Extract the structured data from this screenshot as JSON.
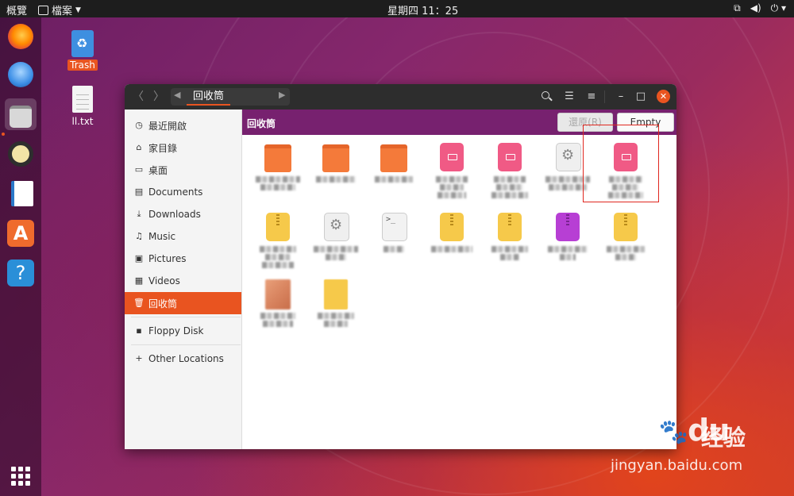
{
  "topbar": {
    "activities": "概覽",
    "app_menu": "檔案",
    "clock": "星期四 11：25",
    "status_icons": [
      "network-icon",
      "volume-icon",
      "power-icon"
    ]
  },
  "dock": {
    "apps": [
      "Firefox",
      "Thunderbird",
      "Files",
      "Rhythmbox",
      "LibreOffice Writer",
      "Ubuntu Software",
      "Help"
    ],
    "active": "Files"
  },
  "desktop": {
    "icons": [
      {
        "label": "Trash"
      },
      {
        "label": "ll.txt"
      }
    ]
  },
  "window": {
    "path": "回收筒",
    "location_label": "回收筒",
    "restore_label": "還原(R)",
    "empty_label": "Empty"
  },
  "sidebar": {
    "items": [
      {
        "label": "最近開啟",
        "icon": "clock-icon"
      },
      {
        "label": "家目錄",
        "icon": "home-icon"
      },
      {
        "label": "桌面",
        "icon": "desktop-icon"
      },
      {
        "label": "Documents",
        "icon": "document-icon"
      },
      {
        "label": "Downloads",
        "icon": "download-icon"
      },
      {
        "label": "Music",
        "icon": "music-icon"
      },
      {
        "label": "Pictures",
        "icon": "picture-icon"
      },
      {
        "label": "Videos",
        "icon": "video-icon"
      },
      {
        "label": "回收筒",
        "icon": "trash-icon"
      },
      {
        "label": "Floppy Disk",
        "icon": "floppy-icon"
      },
      {
        "label": "Other Locations",
        "icon": "plus-icon"
      }
    ],
    "active": "回收筒"
  },
  "files": [
    {
      "type": "folder",
      "name": "..."
    },
    {
      "type": "folder",
      "name": "..."
    },
    {
      "type": "folder",
      "name": "..."
    },
    {
      "type": "deb",
      "name": "..."
    },
    {
      "type": "deb",
      "name": "..."
    },
    {
      "type": "settings",
      "name": "..."
    },
    {
      "type": "deb",
      "name": "..."
    },
    {
      "type": "zip",
      "name": "..."
    },
    {
      "type": "settings",
      "name": "..."
    },
    {
      "type": "script",
      "name": "..."
    },
    {
      "type": "zip",
      "name": "..."
    },
    {
      "type": "zip",
      "name": "..."
    },
    {
      "type": "zip-purple",
      "name": "..."
    },
    {
      "type": "zip",
      "name": "..."
    },
    {
      "type": "image",
      "name": "..."
    },
    {
      "type": "document",
      "name": "..."
    }
  ],
  "watermark": {
    "logo": "Bai",
    "logo_tail": "du",
    "logo_cn": "经验",
    "url": "jingyan.baidu.com"
  }
}
